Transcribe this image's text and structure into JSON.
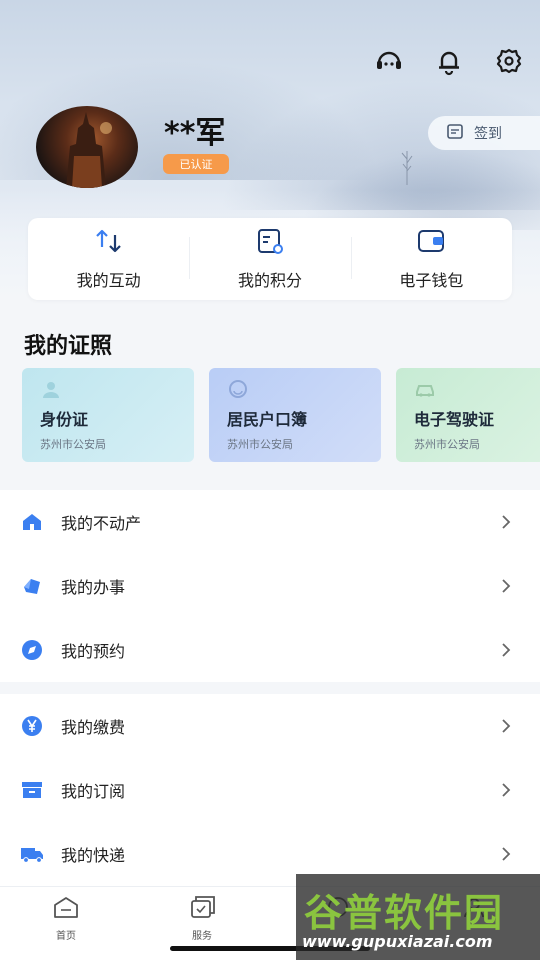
{
  "header": {
    "username": "**军",
    "verified_badge": "已认证",
    "checkin_label": "签到",
    "icons": [
      "customer-service-icon",
      "bell-icon",
      "gear-icon"
    ]
  },
  "quick_actions": [
    {
      "label": "我的互动",
      "icon": "interaction-icon"
    },
    {
      "label": "我的积分",
      "icon": "points-icon"
    },
    {
      "label": "电子钱包",
      "icon": "wallet-icon"
    }
  ],
  "certificates": {
    "title": "我的证照",
    "items": [
      {
        "name": "身份证",
        "issuer": "苏州市公安局",
        "icon": "person-icon"
      },
      {
        "name": "居民户口簿",
        "issuer": "苏州市公安局",
        "icon": "face-icon"
      },
      {
        "name": "电子驾驶证",
        "issuer": "苏州市公安局",
        "icon": "car-icon"
      }
    ]
  },
  "menu_group_1": [
    {
      "label": "我的不动产",
      "icon": "house-icon"
    },
    {
      "label": "我的办事",
      "icon": "tag-icon"
    },
    {
      "label": "我的预约",
      "icon": "compass-icon"
    }
  ],
  "menu_group_2": [
    {
      "label": "我的缴费",
      "icon": "yen-icon"
    },
    {
      "label": "我的订阅",
      "icon": "archive-icon"
    },
    {
      "label": "我的快递",
      "icon": "truck-icon"
    }
  ],
  "tabbar": [
    {
      "label": "首页",
      "icon": "home-icon"
    },
    {
      "label": "服务",
      "icon": "service-icon"
    },
    {
      "label": "",
      "icon": "tab3-icon"
    },
    {
      "label": "",
      "icon": "tab4-icon"
    }
  ],
  "watermark": {
    "title": "谷普软件园",
    "url": "www.gupuxiazai.com"
  },
  "colors": {
    "accent_blue": "#3b7ff0",
    "badge_orange": "#f69a4a",
    "watermark_green": "#8ac43f"
  }
}
